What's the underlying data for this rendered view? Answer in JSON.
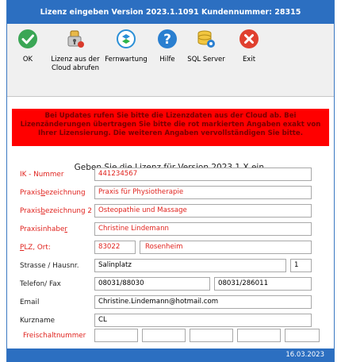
{
  "window": {
    "title": "Lizenz eingeben  Version 2023.1.1091  Kundennummer: 28315"
  },
  "toolbar": {
    "ok": "OK",
    "cloud_line1": "Lizenz aus der",
    "cloud_line2": "Cloud abrufen",
    "remote": "Fernwartung",
    "help": "Hilfe",
    "sql": "SQL Server",
    "exit": "Exit"
  },
  "alert": {
    "line1": "Bei Updates rufen Sie bitte die Lizenzdaten aus der Cloud ab. Bei",
    "line2": "Lizenzänderungen übertragen Sie bitte die rot markierten Angaben exakt von",
    "line3": "Ihrer Lizensierung. Die weiteren Angaben vervollständigen Sie bitte."
  },
  "instruction": "Geben Sie die Lizenz für Version 2023.1.X ein.",
  "form": {
    "ik_label": "IK - Nummer",
    "ik_value": "441234567",
    "praxis1_label_a": "Praxis",
    "praxis1_label_b": "b",
    "praxis1_label_c": "ezeichnung",
    "praxis1_value": "Praxis für Physiotherapie",
    "praxis2_label_a": "Praxis",
    "praxis2_label_b": "b",
    "praxis2_label_c": "ezeichnung 2",
    "praxis2_value": "Osteopathie und Massage",
    "owner_label_a": "Praxisinhabe",
    "owner_label_b": "r",
    "owner_value": "Christine Lindemann",
    "plz_label_a": "P",
    "plz_label_b": "LZ, Ort:",
    "plz_value": "83022",
    "city_value": "Rosenheim",
    "street_label": "Strasse / Hausnr.",
    "street_value": "Salinplatz",
    "house_value": "1",
    "phone_label": "Telefon/ Fax",
    "phone_value": "08031/88030",
    "fax_value": "08031/286011",
    "email_label": "Email",
    "email_value": "Christine.Lindemann@hotmail.com",
    "short_label": "Kurzname",
    "short_value": "CL",
    "unlock_label": "Freischaltnummer",
    "unlock_values": [
      "",
      "",
      "",
      "",
      ""
    ]
  },
  "status": {
    "date": "16.03.2023"
  },
  "colors": {
    "title_bar": "#2c6fc1",
    "alert_bg": "#ff0000",
    "required_label": "#e0231e"
  }
}
